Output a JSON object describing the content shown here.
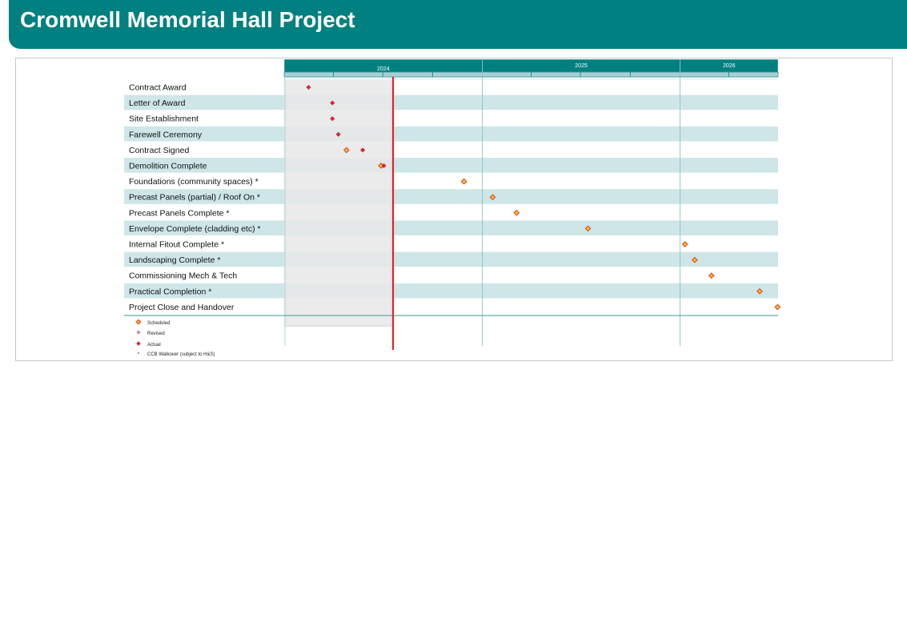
{
  "header": {
    "title": "Cromwell Memorial Hall Project"
  },
  "colors": {
    "brand": "#008080",
    "band": "#cfe6e8",
    "past_shade": "#e8e8e8",
    "actual": "#e0242a",
    "scheduled_fill": "#ffd23f",
    "scheduled_stroke": "#e0502a",
    "revised": "#d88fa0",
    "today": "#e0242a"
  },
  "chart_data": {
    "type": "gantt-milestones",
    "time_axis": {
      "start": "2024-01-01",
      "end": "2026-07-01",
      "years": [
        {
          "label": "2024",
          "start": "2024-01-01",
          "end": "2025-01-01"
        },
        {
          "label": "2025",
          "start": "2025-01-01",
          "end": "2026-01-01"
        },
        {
          "label": "2026",
          "start": "2026-01-01",
          "end": "2026-07-01"
        }
      ],
      "quarter_ticks": [
        "2024-04-01",
        "2024-07-01",
        "2024-10-01",
        "2025-04-01",
        "2025-07-01",
        "2025-10-01",
        "2026-04-01"
      ],
      "past_shading_end": "2024-07-20",
      "today_line": "2024-07-20"
    },
    "tasks": [
      {
        "label": "Contract Award",
        "milestones": [
          {
            "kind": "actual",
            "date": "2024-02-15"
          }
        ]
      },
      {
        "label": "Letter of Award",
        "milestones": [
          {
            "kind": "actual",
            "date": "2024-03-30"
          }
        ]
      },
      {
        "label": "Site Establishment",
        "milestones": [
          {
            "kind": "actual",
            "date": "2024-03-30"
          }
        ]
      },
      {
        "label": "Farewell Ceremony",
        "milestones": [
          {
            "kind": "actual",
            "date": "2024-04-10"
          }
        ]
      },
      {
        "label": "Contract Signed",
        "milestones": [
          {
            "kind": "scheduled",
            "date": "2024-04-25"
          },
          {
            "kind": "actual",
            "date": "2024-05-25"
          }
        ]
      },
      {
        "label": "Demolition Complete",
        "milestones": [
          {
            "kind": "scheduled",
            "date": "2024-06-28"
          },
          {
            "kind": "actual",
            "date": "2024-07-03"
          }
        ]
      },
      {
        "label": "Foundations (community spaces) *",
        "milestones": [
          {
            "kind": "scheduled",
            "date": "2024-11-28"
          }
        ]
      },
      {
        "label": "Precast Panels (partial) / Roof On *",
        "milestones": [
          {
            "kind": "scheduled",
            "date": "2025-01-20"
          }
        ]
      },
      {
        "label": "Precast Panels Complete *",
        "milestones": [
          {
            "kind": "scheduled",
            "date": "2025-03-05"
          }
        ]
      },
      {
        "label": "Envelope Complete (cladding etc) *",
        "milestones": [
          {
            "kind": "scheduled",
            "date": "2025-07-15"
          }
        ]
      },
      {
        "label": "Internal Fitout Complete *",
        "milestones": [
          {
            "kind": "scheduled",
            "date": "2026-01-10"
          }
        ]
      },
      {
        "label": "Landscaping Complete *",
        "milestones": [
          {
            "kind": "scheduled",
            "date": "2026-01-28"
          }
        ]
      },
      {
        "label": "Commissioning Mech & Tech",
        "milestones": [
          {
            "kind": "scheduled",
            "date": "2026-02-28"
          }
        ]
      },
      {
        "label": "Practical Completion *",
        "milestones": [
          {
            "kind": "scheduled",
            "date": "2026-05-28"
          }
        ]
      },
      {
        "label": "Project Close and Handover",
        "milestones": [
          {
            "kind": "scheduled",
            "date": "2026-06-30"
          }
        ]
      }
    ],
    "legend": [
      {
        "kind": "scheduled",
        "label": "Scheduled"
      },
      {
        "kind": "revised",
        "label": "Revised"
      },
      {
        "kind": "actual",
        "label": "Actual"
      },
      {
        "kind": "note",
        "label": "CCB Walkover (subject to H&S)"
      }
    ]
  }
}
